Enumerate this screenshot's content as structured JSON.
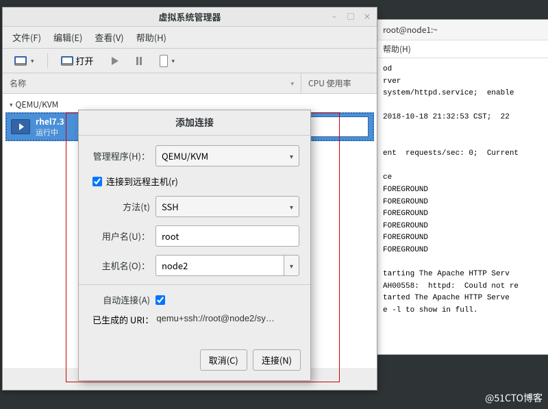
{
  "terminal": {
    "title": "root@node1:~",
    "menu_help": "帮助(H)",
    "content": "od\nrver\nsystem/httpd.service;  enable\n\n2018-10-18 21:32:53 CST;  22\n\n\nent  requests/sec: 0;  Current\n\nce\nFOREGROUND\nFOREGROUND\nFOREGROUND\nFOREGROUND\nFOREGROUND\nFOREGROUND\n\ntarting The Apache HTTP Serv\nAH00558:  httpd:  Could not re\ntarted The Apache HTTP Serve\ne -l to show in full."
  },
  "main": {
    "title": "虚拟系统管理器",
    "menu": {
      "file": "文件(F)",
      "edit": "编辑(E)",
      "view": "查看(V)",
      "help": "帮助(H)"
    },
    "toolbar": {
      "open": "打开"
    },
    "columns": {
      "name": "名称",
      "cpu": "CPU 使用率"
    },
    "connection": "QEMU/KVM",
    "vm": {
      "name": "rhel7.3",
      "status": "运行中"
    }
  },
  "dialog": {
    "title": "添加连接",
    "labels": {
      "hypervisor": "管理程序(H)：",
      "remote": "连接到远程主机(r)",
      "method": "方法(t)",
      "username": "用户名(U)：",
      "hostname": "主机名(O)：",
      "autoconnect": "自动连接(A)",
      "generated_uri": "已生成的 URI："
    },
    "values": {
      "hypervisor": "QEMU/KVM",
      "method": "SSH",
      "username": "root",
      "hostname": "node2",
      "uri": "qemu+ssh://root@node2/sy…"
    },
    "buttons": {
      "cancel": "取消(C)",
      "connect": "连接(N)"
    }
  },
  "watermark": "@51CTO博客"
}
